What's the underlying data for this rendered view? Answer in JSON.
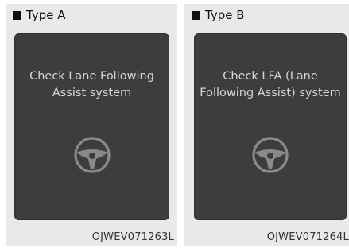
{
  "panels": [
    {
      "title": "Type A",
      "message": "Check Lane Following\nAssist system",
      "icon": "steering-wheel-icon",
      "code": "OJWEV071263L"
    },
    {
      "title": "Type B",
      "message": "Check LFA (Lane\nFollowing Assist) system",
      "icon": "steering-wheel-icon",
      "code": "OJWEV071264L"
    }
  ],
  "colors": {
    "panel_bg": "#e9e9e9",
    "screen_bg": "#3d3d3d",
    "screen_text": "#d6d6d6",
    "icon_stroke": "#8a8a8a"
  }
}
